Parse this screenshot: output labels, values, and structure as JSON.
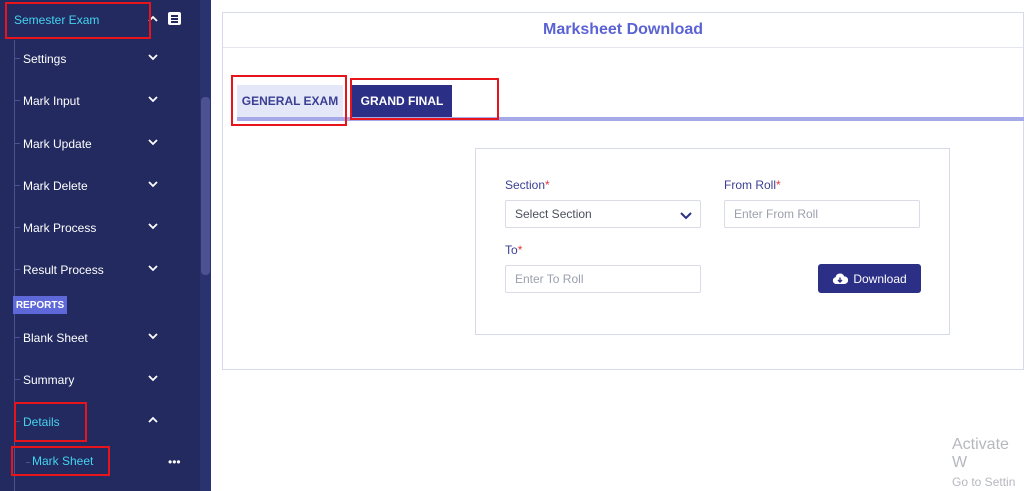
{
  "sidebar": {
    "top_item": {
      "label": "Semester Exam",
      "expanded": true
    },
    "items": [
      {
        "label": "Settings"
      },
      {
        "label": "Mark Input"
      },
      {
        "label": "Mark Update"
      },
      {
        "label": "Mark Delete"
      },
      {
        "label": "Mark Process"
      },
      {
        "label": "Result Process"
      }
    ],
    "section_badge": "REPORTS",
    "report_items": [
      {
        "label": "Blank Sheet"
      },
      {
        "label": "Summary"
      },
      {
        "label": "Details",
        "expanded": true
      }
    ],
    "sub_item": {
      "label": "Mark Sheet",
      "more": "•••"
    }
  },
  "card": {
    "title": "Marksheet Download",
    "tabs": [
      {
        "label": "GENERAL EXAM",
        "active": false
      },
      {
        "label": "GRAND FINAL",
        "active": true
      }
    ],
    "form": {
      "section": {
        "label": "Section",
        "required_mark": "*",
        "value": "Select Section"
      },
      "from_roll": {
        "label": "From Roll",
        "required_mark": "*",
        "placeholder": "Enter From Roll"
      },
      "to": {
        "label": "To",
        "required_mark": "*",
        "placeholder": "Enter To Roll"
      },
      "download_label": "Download"
    }
  },
  "watermark": {
    "title": "Activate W",
    "subtitle": "Go to Settin"
  },
  "colors": {
    "sidebar_bg": "#222a5f",
    "sidebar_active_text": "#45d3f0",
    "accent": "#2b2f86",
    "title": "#5b63d3",
    "highlight_box": "#e8141b"
  }
}
